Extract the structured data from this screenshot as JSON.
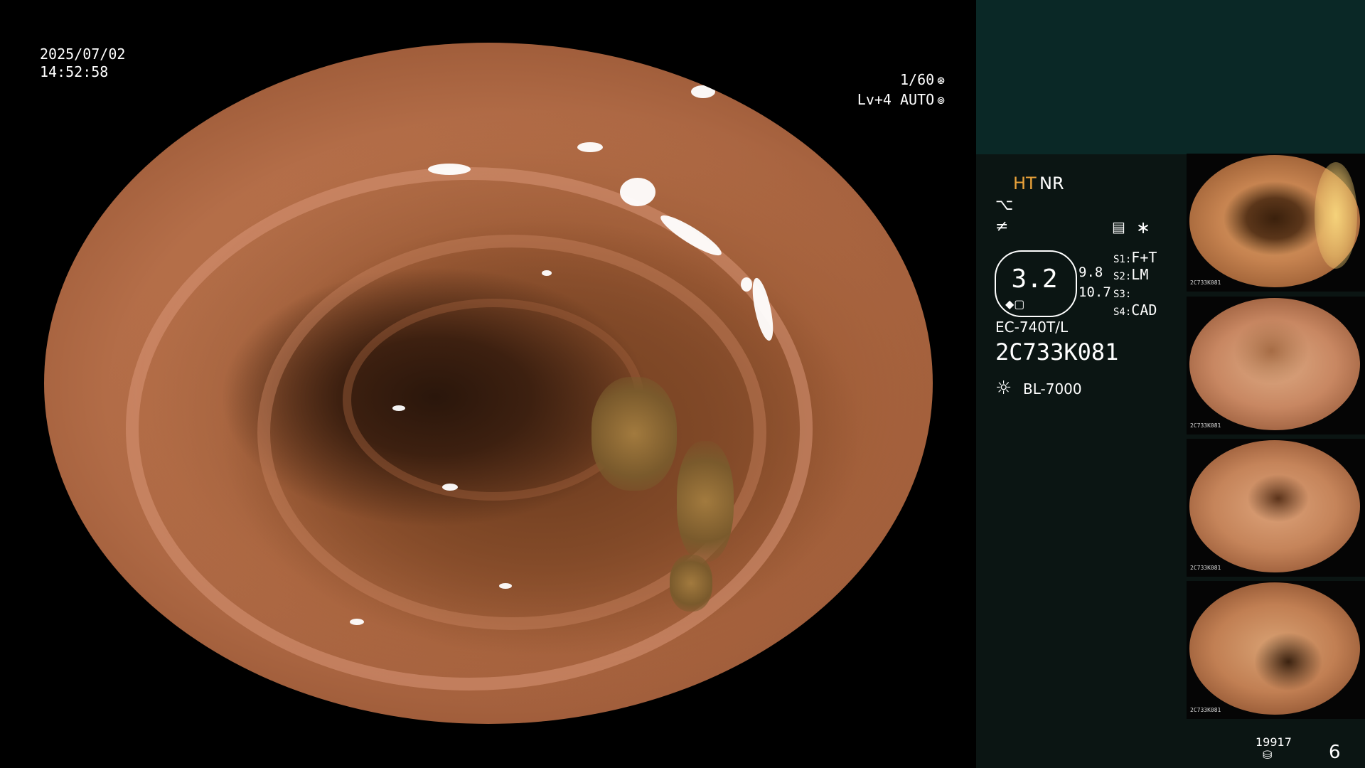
{
  "osd": {
    "date": "2025/07/02",
    "time": "14:52:58",
    "shutter": "1/60",
    "level": "Lv+4 AUTO"
  },
  "panel": {
    "mode_ht": "HT",
    "mode_nr": "NR",
    "zoom": "3.2",
    "value_a": "9.8",
    "value_b": "10.7",
    "settings": [
      {
        "key": "S1:",
        "val": "F+T"
      },
      {
        "key": "S2:",
        "val": "LM"
      },
      {
        "key": "S3:",
        "val": ""
      },
      {
        "key": "S4:",
        "val": "CAD"
      }
    ],
    "scope_model": "EC-740T/L",
    "scope_serial": "2C733K081",
    "light_source": "BL-7000"
  },
  "thumbnails": [
    {
      "caption": "2C733K081"
    },
    {
      "caption": "2C733K081"
    },
    {
      "caption": "2C733K081"
    },
    {
      "caption": "2C733K081"
    }
  ],
  "footer": {
    "count": "19917",
    "page": "6"
  },
  "colors": {
    "accent_ht": "#e8a13a",
    "panel_bg": "#0b1513",
    "panel_top": "#0a2826"
  },
  "icons": {
    "shutter": "aperture-icon",
    "level": "auto-exposure-icon",
    "enhance": "enhance-icon",
    "filter": "filter-icon",
    "settings": "settings-icon",
    "star": "star-icon",
    "light": "light-bulb-icon",
    "storage": "database-icon"
  }
}
